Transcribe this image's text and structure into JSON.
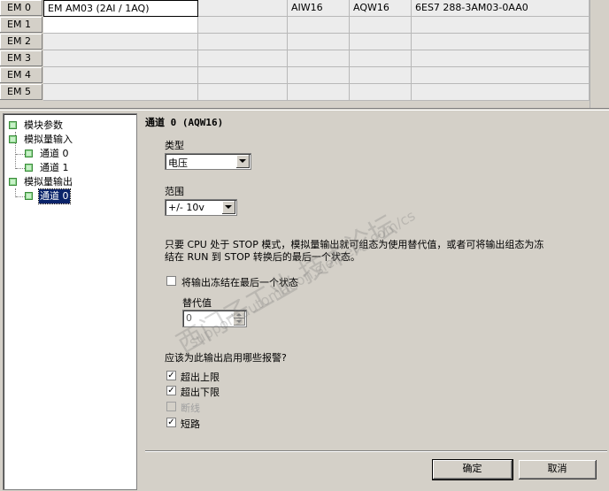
{
  "modules": [
    {
      "slot": "EM 0",
      "module": "EM AM03 (2AI / 1AQ)",
      "input": "AIW16",
      "output": "AQW16",
      "order": "6ES7 288-3AM03-0AA0"
    },
    {
      "slot": "EM 1",
      "module": "",
      "input": "",
      "output": "",
      "order": ""
    },
    {
      "slot": "EM 2",
      "module": "",
      "input": "",
      "output": "",
      "order": ""
    },
    {
      "slot": "EM 3",
      "module": "",
      "input": "",
      "output": "",
      "order": ""
    },
    {
      "slot": "EM 4",
      "module": "",
      "input": "",
      "output": "",
      "order": ""
    },
    {
      "slot": "EM 5",
      "module": "",
      "input": "",
      "output": "",
      "order": ""
    }
  ],
  "tree": {
    "module_params": "模块参数",
    "analog_input": "模拟量输入",
    "ai_channel0": "通道 0",
    "ai_channel1": "通道 1",
    "analog_output": "模拟量输出",
    "aq_channel0": "通道 0"
  },
  "panel": {
    "heading": "通道 0 (AQW16)",
    "type_label": "类型",
    "type_value": "电压",
    "range_label": "范围",
    "range_value": "+/- 10v",
    "stop_text_line1": "只要 CPU 处于 STOP 模式，模拟量输出就可组态为使用替代值，或者可将输出组态为冻",
    "stop_text_line2": "结在 RUN 到 STOP 转换后的最后一个状态。",
    "freeze_label": "将输出冻结在最后一个状态",
    "freeze_checked": false,
    "substitute_label": "替代值",
    "substitute_value": "0",
    "alarm_question": "应该为此输出启用哪些报警?",
    "alarms": [
      {
        "label": "超出上限",
        "checked": true,
        "enabled": true
      },
      {
        "label": "超出下限",
        "checked": true,
        "enabled": true
      },
      {
        "label": "断线",
        "checked": false,
        "enabled": false
      },
      {
        "label": "短路",
        "checked": true,
        "enabled": true
      }
    ],
    "check_mark": "✓"
  },
  "buttons": {
    "ok": "确定",
    "cancel": "取消"
  },
  "watermark": {
    "text": "西门子工业 技术论坛",
    "url": "support.automation.siemens.com/cs"
  }
}
